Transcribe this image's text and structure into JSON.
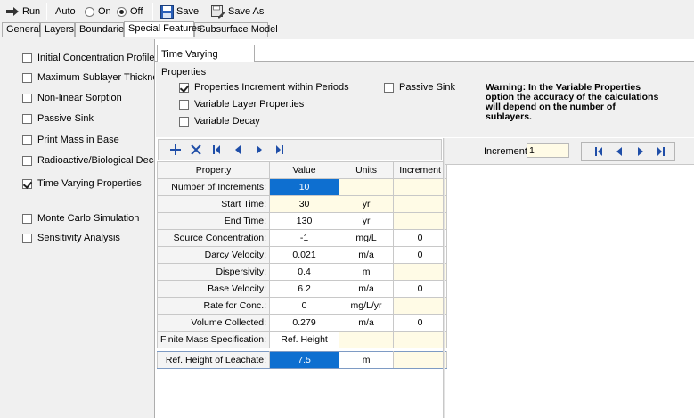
{
  "toolbar": {
    "run_label": "Run",
    "auto_label": "Auto",
    "on_label": "On",
    "off_label": "Off",
    "auto_mode": "Off",
    "save_label": "Save",
    "save_as_label": "Save As"
  },
  "tabs": [
    {
      "label": "General",
      "active": false
    },
    {
      "label": "Layers",
      "active": false
    },
    {
      "label": "Boundaries",
      "active": false
    },
    {
      "label": "Special Features",
      "active": true
    },
    {
      "label": "Subsurface Model",
      "active": false
    }
  ],
  "special_features": [
    {
      "label": "Initial Concentration Profile",
      "checked": false
    },
    {
      "label": "Maximum Sublayer Thickness",
      "checked": false
    },
    {
      "label": "Non-linear Sorption",
      "checked": false
    },
    {
      "label": "Passive Sink",
      "checked": false
    },
    {
      "label": "Print Mass in Base",
      "checked": false
    },
    {
      "label": "Radioactive/Biological Decay",
      "checked": false
    },
    {
      "label": "Time Varying Properties",
      "checked": true
    },
    {
      "label": "Monte Carlo Simulation",
      "checked": false
    },
    {
      "label": "Sensitivity Analysis",
      "checked": false
    }
  ],
  "inner_tab": {
    "label": "Time Varying Properties"
  },
  "options": {
    "increment_within_periods": {
      "label": "Properties Increment within Periods",
      "checked": true
    },
    "variable_layer_properties": {
      "label": "Variable Layer Properties",
      "checked": false
    },
    "variable_decay": {
      "label": "Variable Decay",
      "checked": false
    },
    "passive_sink": {
      "label": "Passive Sink",
      "checked": false
    }
  },
  "warning_lines": [
    "Warning: In the Variable Properties",
    "option the accuracy of the calculations",
    "will depend on the number of",
    "sublayers."
  ],
  "grid_icons": [
    "add-icon",
    "delete-icon",
    "first-icon",
    "previous-icon",
    "next-icon",
    "last-icon"
  ],
  "table": {
    "headers": [
      "Property",
      "Value",
      "Units",
      "Increment"
    ],
    "rows": [
      {
        "property": "Number of Increments:",
        "value": "10",
        "units": "",
        "increment": ""
      },
      {
        "property": "Start Time:",
        "value": "30",
        "units": "yr",
        "increment": ""
      },
      {
        "property": "End Time:",
        "value": "130",
        "units": "yr",
        "increment": ""
      },
      {
        "property": "Source Concentration:",
        "value": "-1",
        "units": "mg/L",
        "increment": "0"
      },
      {
        "property": "Darcy Velocity:",
        "value": "0.021",
        "units": "m/a",
        "increment": "0"
      },
      {
        "property": "Dispersivity:",
        "value": "0.4",
        "units": "m",
        "increment": ""
      },
      {
        "property": "Base Velocity:",
        "value": "6.2",
        "units": "m/a",
        "increment": "0"
      },
      {
        "property": "Rate for Conc.:",
        "value": "0",
        "units": "mg/L/yr",
        "increment": ""
      },
      {
        "property": "Volume Collected:",
        "value": "0.279",
        "units": "m/a",
        "increment": "0"
      },
      {
        "property": "Finite Mass Specification:",
        "value": "Ref. Height",
        "units": "",
        "increment": ""
      }
    ],
    "extra_row": {
      "property": "Ref. Height of Leachate:",
      "value": "7.5",
      "units": "m",
      "increment": ""
    }
  },
  "increment_panel": {
    "label": "Increment:",
    "value": "1"
  },
  "colors": {
    "selection": "#0e6fd0",
    "input_yellow": "#fffbe6",
    "icon_blue": "#1f4ea8"
  }
}
